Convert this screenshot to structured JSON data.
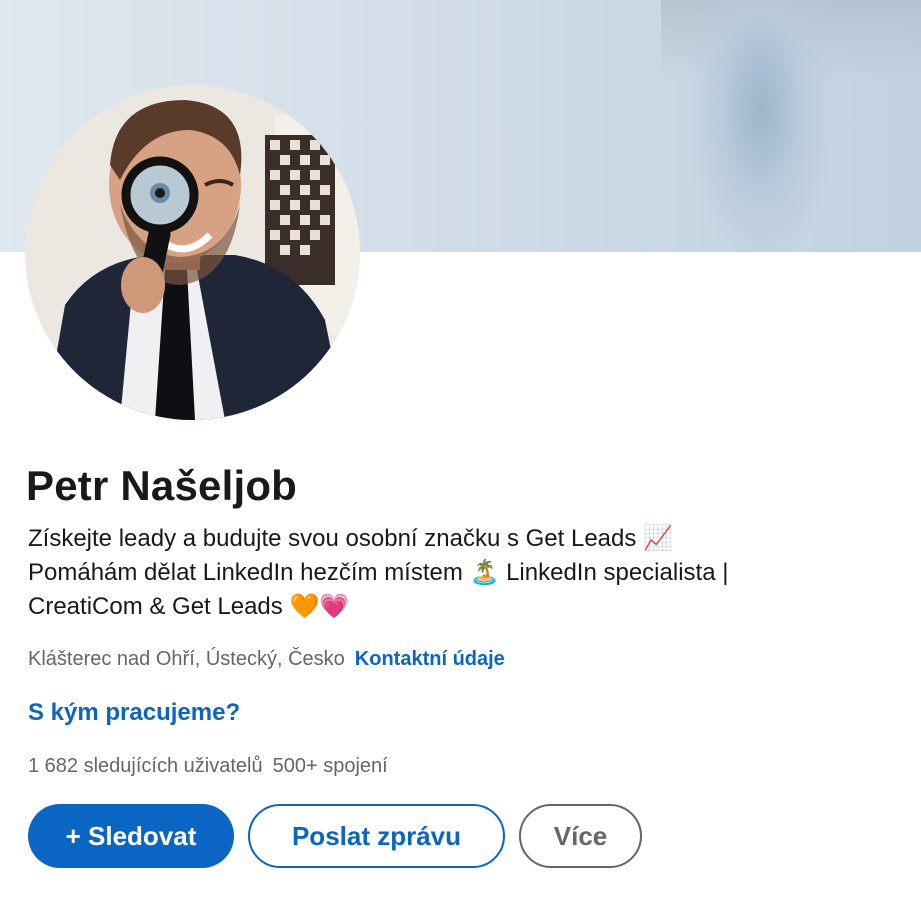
{
  "profile": {
    "name": "Petr Našeljob",
    "headline_lines": [
      "Získejte leady a budujte svou osobní značku s Get Leads 📈",
      "Pomáhám dělat LinkedIn hezčím místem 🏝️ LinkedIn specialista |",
      "CreatiCom & Get Leads 🧡💗"
    ],
    "location": "Klášterec nad Ohří, Ústecký, Česko",
    "contact_link": "Kontaktní údaje",
    "cta_link": "S kým pracujeme?",
    "followers": "1 682 sledujících uživatelů",
    "connections": "500+ spojení"
  },
  "actions": {
    "follow_label": "+ Sledovat",
    "message_label": "Poslat zprávu",
    "more_label": "Více"
  },
  "colors": {
    "accent": "#0a66c2",
    "text": "#191919",
    "muted": "#666666"
  }
}
